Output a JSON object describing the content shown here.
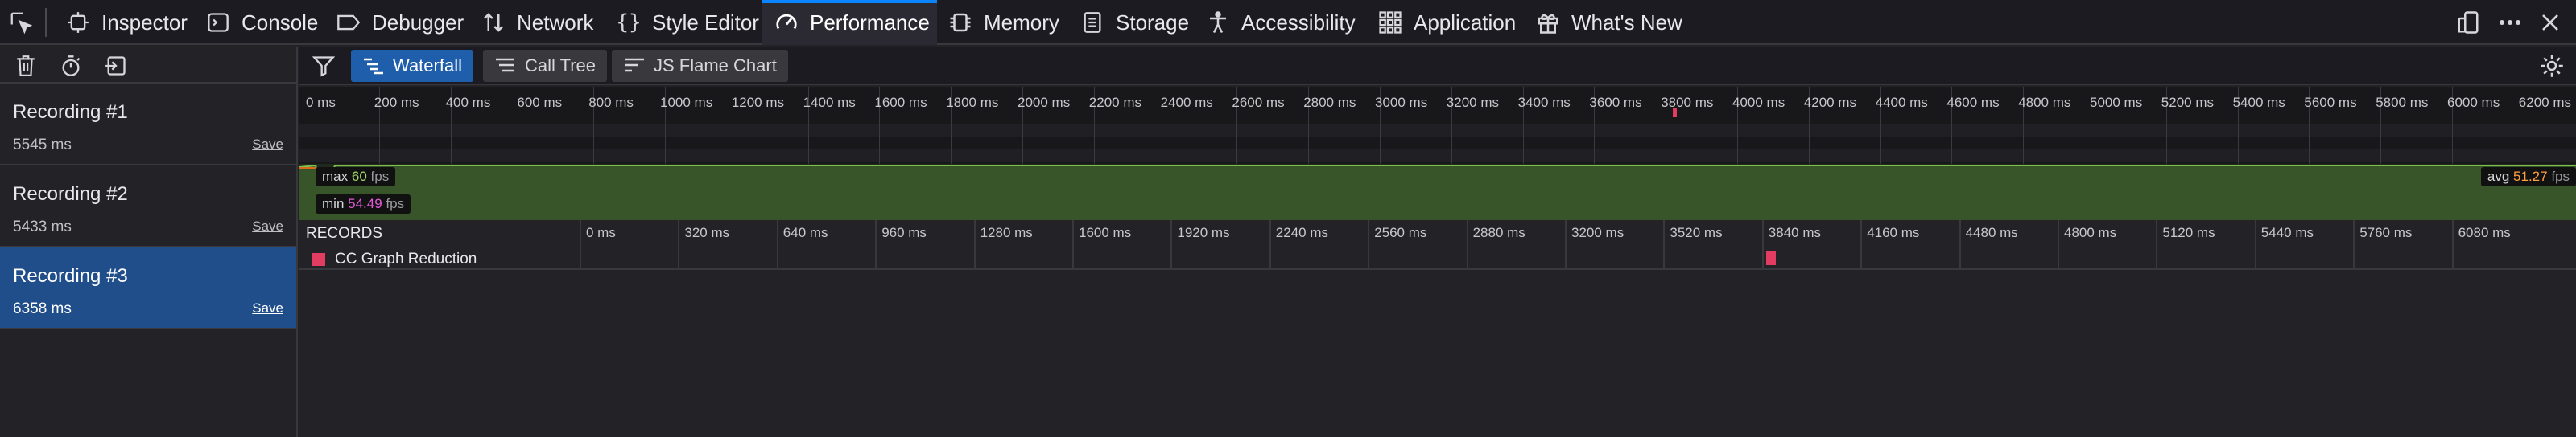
{
  "toolbar": {
    "tabs": [
      {
        "label": "Inspector",
        "icon": "inspector-icon"
      },
      {
        "label": "Console",
        "icon": "console-icon"
      },
      {
        "label": "Debugger",
        "icon": "debugger-icon"
      },
      {
        "label": "Network",
        "icon": "network-icon"
      },
      {
        "label": "Style Editor",
        "icon": "style-editor-icon"
      },
      {
        "label": "Performance",
        "icon": "performance-icon"
      },
      {
        "label": "Memory",
        "icon": "memory-icon"
      },
      {
        "label": "Storage",
        "icon": "storage-icon"
      },
      {
        "label": "Accessibility",
        "icon": "accessibility-icon"
      },
      {
        "label": "Application",
        "icon": "application-icon"
      },
      {
        "label": "What's New",
        "icon": "gift-icon"
      }
    ],
    "selected_tab": "Performance",
    "accent": "#0a84ff"
  },
  "sidebar": {
    "recordings": [
      {
        "title": "Recording #1",
        "duration": "5545 ms",
        "save": "Save"
      },
      {
        "title": "Recording #2",
        "duration": "5433 ms",
        "save": "Save"
      },
      {
        "title": "Recording #3",
        "duration": "6358 ms",
        "save": "Save"
      }
    ],
    "selected_recording": "Recording #3"
  },
  "view": {
    "tabs": [
      "Waterfall",
      "Call Tree",
      "JS Flame Chart"
    ],
    "selected_tab": "Waterfall"
  },
  "overview": {
    "ticks": [
      "0 ms",
      "200 ms",
      "400 ms",
      "600 ms",
      "800 ms",
      "1000 ms",
      "1200 ms",
      "1400 ms",
      "1600 ms",
      "1800 ms",
      "2000 ms",
      "2200 ms",
      "2400 ms",
      "2600 ms",
      "2800 ms",
      "3000 ms",
      "3200 ms",
      "3400 ms",
      "3600 ms",
      "3800 ms",
      "4000 ms",
      "4200 ms",
      "4400 ms",
      "4600 ms",
      "4800 ms",
      "5000 ms",
      "5200 ms",
      "5400 ms",
      "5600 ms",
      "5800 ms",
      "6000 ms",
      "6200 ms"
    ]
  },
  "fps": {
    "max_label": "max",
    "max_value": "60",
    "min_label": "min",
    "min_value": "54.49",
    "avg_label": "avg",
    "avg_value": "51.27",
    "unit": "fps"
  },
  "records": {
    "header": "RECORDS",
    "ticks": [
      "0 ms",
      "320 ms",
      "640 ms",
      "960 ms",
      "1280 ms",
      "1600 ms",
      "1920 ms",
      "2240 ms",
      "2560 ms",
      "2880 ms",
      "3200 ms",
      "3520 ms",
      "3840 ms",
      "4160 ms",
      "4480 ms",
      "4800 ms",
      "5120 ms",
      "5440 ms",
      "5760 ms",
      "6080 ms"
    ],
    "items": [
      {
        "label": "CC Graph Reduction",
        "color": "#e23c63"
      }
    ]
  }
}
